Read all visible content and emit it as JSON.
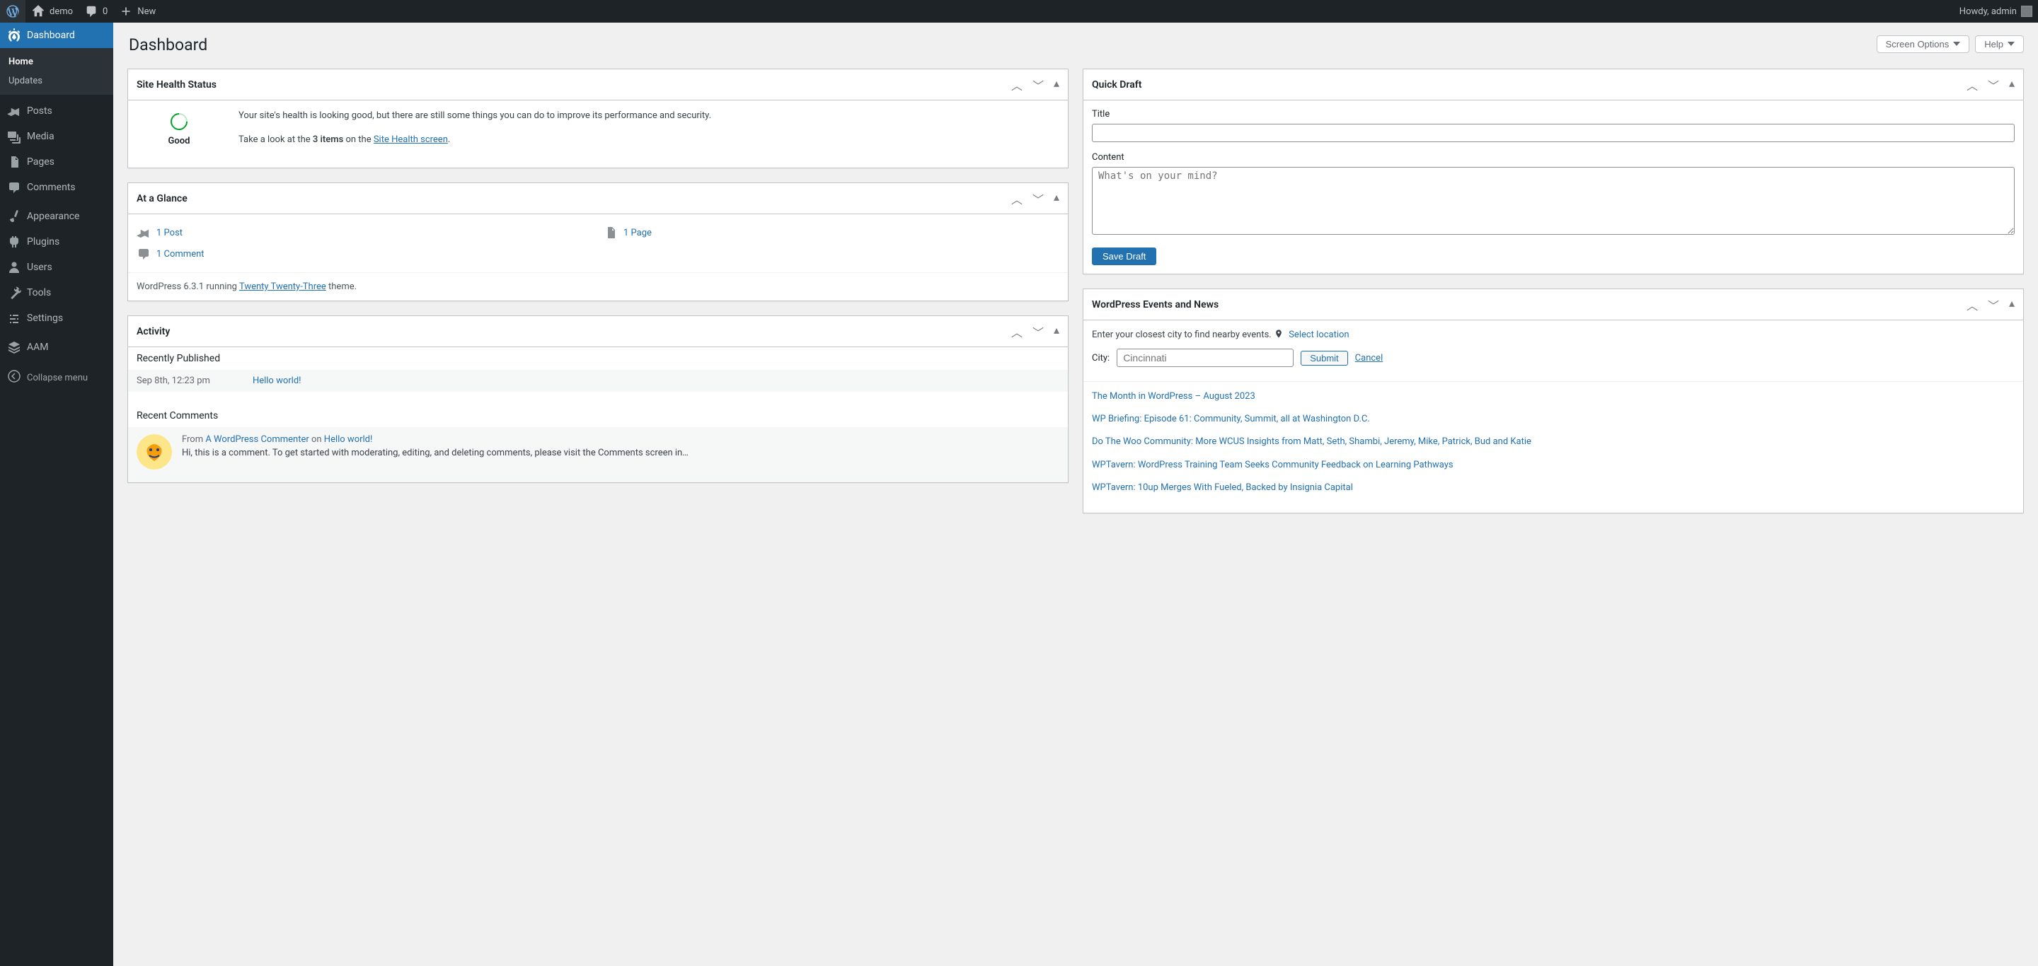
{
  "adminbar": {
    "site_name": "demo",
    "comments_count": "0",
    "new_label": "New",
    "howdy_prefix": "Howdy, ",
    "user_name": "admin"
  },
  "menu": {
    "dashboard": "Dashboard",
    "home": "Home",
    "updates": "Updates",
    "posts": "Posts",
    "media": "Media",
    "pages": "Pages",
    "comments": "Comments",
    "appearance": "Appearance",
    "plugins": "Plugins",
    "users": "Users",
    "tools": "Tools",
    "settings": "Settings",
    "aam": "AAM",
    "collapse": "Collapse menu"
  },
  "header": {
    "title": "Dashboard",
    "screen_options": "Screen Options",
    "help": "Help"
  },
  "site_health": {
    "title": "Site Health Status",
    "status": "Good",
    "desc": "Your site's health is looking good, but there are still some things you can do to improve its performance and security.",
    "cta_pre": "Take a look at the ",
    "cta_items": "3 items",
    "cta_mid": " on the ",
    "cta_link": "Site Health screen",
    "cta_post": "."
  },
  "glance": {
    "title": "At a Glance",
    "posts": "1 Post",
    "pages": "1 Page",
    "comments": "1 Comment",
    "wp_pre": "WordPress 6.3.1 running ",
    "theme": "Twenty Twenty-Three",
    "wp_post": " theme."
  },
  "activity": {
    "title": "Activity",
    "recently_published": "Recently Published",
    "pub_time": "Sep 8th, 12:23 pm",
    "pub_title": "Hello world!",
    "recent_comments": "Recent Comments",
    "comment": {
      "from_label": "From ",
      "author": "A WordPress Commenter",
      "on_label": " on ",
      "post": "Hello world!",
      "excerpt": "Hi, this is a comment. To get started with moderating, editing, and deleting comments, please visit the Comments screen in…"
    }
  },
  "quickdraft": {
    "title": "Quick Draft",
    "title_label": "Title",
    "content_label": "Content",
    "content_placeholder": "What's on your mind?",
    "save": "Save Draft"
  },
  "events": {
    "title": "WordPress Events and News",
    "help": "Enter your closest city to find nearby events.",
    "select_location": "Select location",
    "city_label": "City:",
    "city_placeholder": "Cincinnati",
    "submit": "Submit",
    "cancel": "Cancel",
    "news": [
      "The Month in WordPress – August 2023",
      "WP Briefing: Episode 61: Community, Summit, all at Washington D.C.",
      "Do The Woo Community: More WCUS Insights from Matt, Seth, Shambi, Jeremy, Mike, Patrick, Bud and Katie",
      "WPTavern: WordPress Training Team Seeks Community Feedback on Learning Pathways",
      "WPTavern: 10up Merges With Fueled, Backed by Insignia Capital"
    ]
  }
}
